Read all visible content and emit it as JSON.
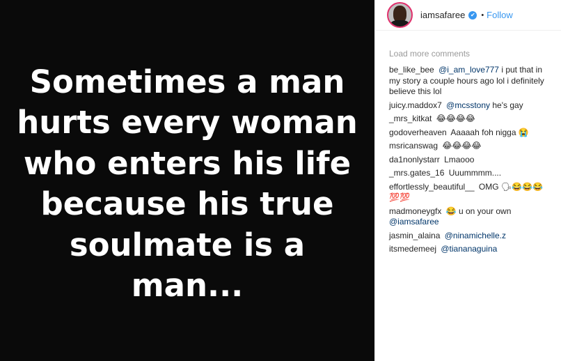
{
  "post": {
    "quote_lines": [
      "Sometimes a man",
      "hurts every woman",
      "who enters his life",
      "because his true",
      "soulmate is a",
      "man..."
    ]
  },
  "header": {
    "username": "iamsafaree",
    "verified_icon": "✔",
    "separator": "•",
    "follow_label": "Follow"
  },
  "comments_panel": {
    "load_more": "Load more comments",
    "comments": [
      {
        "user": "be_like_bee",
        "mention": "@i_am_love777",
        "text": " i put that in my story a couple hours ago lol i definitely believe this lol"
      },
      {
        "user": "juicy.maddox7",
        "mention": "@mcsstony",
        "text": " he's gay"
      },
      {
        "user": "_mrs_kitkat",
        "mention": "",
        "text": "😂😂😂😂"
      },
      {
        "user": "godoverheaven",
        "mention": "",
        "text": "Aaaaah foh nigga 😭"
      },
      {
        "user": "msricanswag",
        "mention": "",
        "text": "😂😂😂😂"
      },
      {
        "user": "da1nonlystarr",
        "mention": "",
        "text": "Lmaooo"
      },
      {
        "user": "_mrs.gates_16",
        "mention": "",
        "text": "Uuummmm...."
      },
      {
        "user": "effortlessly_beautiful__",
        "mention": "",
        "text": "OMG 🗣😂😂😂💯💯"
      },
      {
        "user": "madmoneygfx",
        "mention": "",
        "text": "😂 u on your own ",
        "mention_after": "@iamsafaree"
      },
      {
        "user": "jasmin_alaina",
        "mention": "@ninamichelle.z",
        "text": ""
      },
      {
        "user": "itsmedemeej",
        "mention": "@tiananaguina",
        "text": ""
      }
    ]
  },
  "colors": {
    "link_blue": "#3897f0",
    "mention_blue": "#003569",
    "post_background": "#0a0a0a"
  }
}
